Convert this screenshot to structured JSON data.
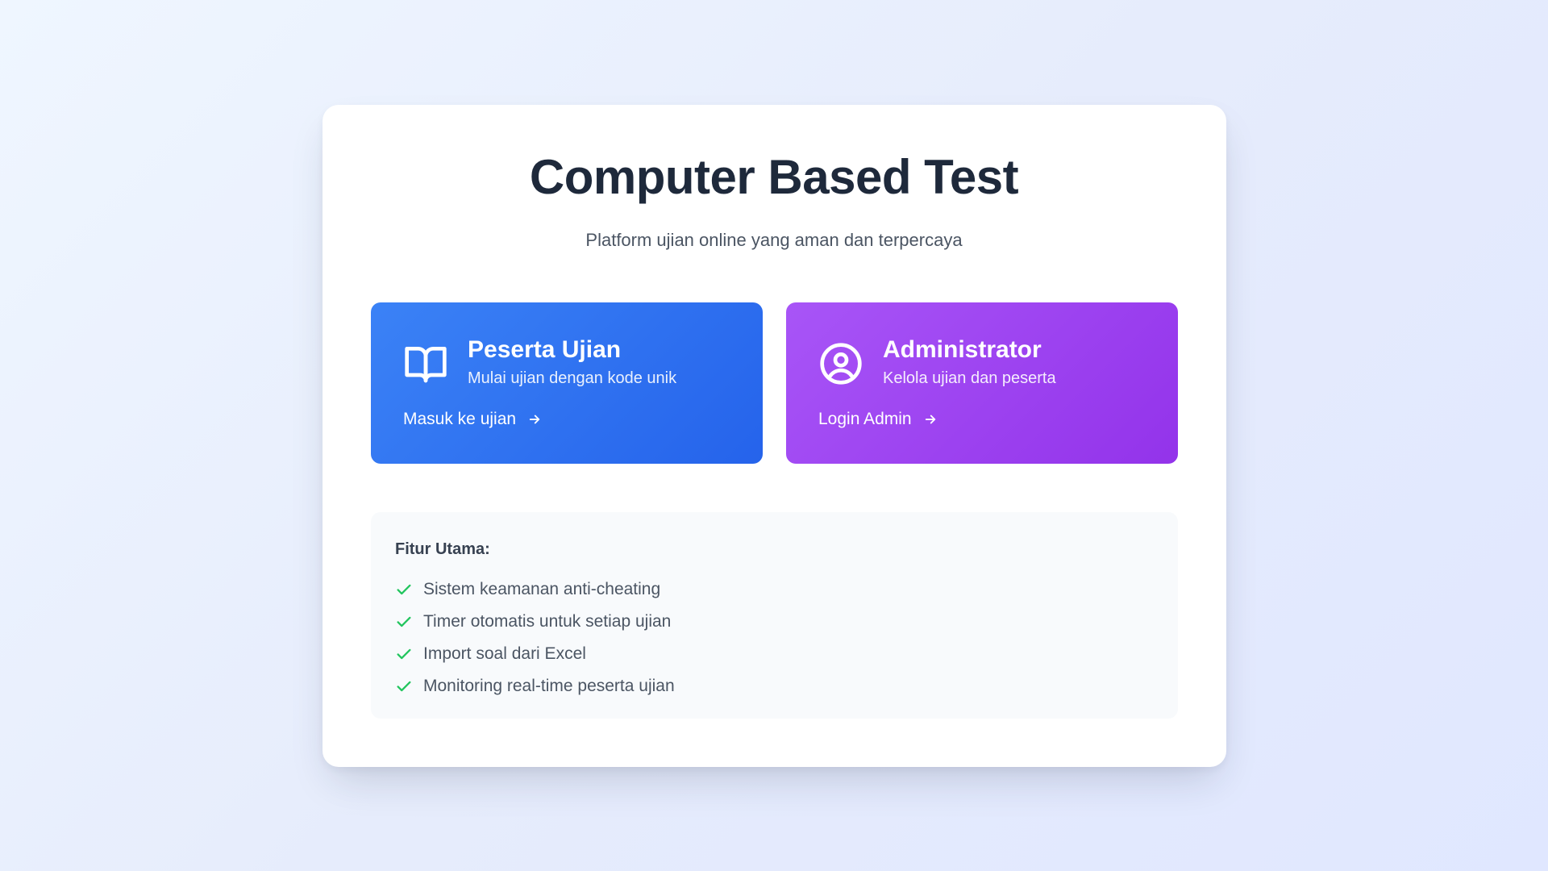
{
  "header": {
    "title": "Computer Based Test",
    "subtitle": "Platform ujian online yang aman dan terpercaya"
  },
  "roles": [
    {
      "title": "Peserta Ujian",
      "description": "Mulai ujian dengan kode unik",
      "action_label": "Masuk ke ujian",
      "icon": "book-open-icon",
      "color": "#2563eb"
    },
    {
      "title": "Administrator",
      "description": "Kelola ujian dan peserta",
      "action_label": "Login Admin",
      "icon": "user-circle-icon",
      "color": "#9333ea"
    }
  ],
  "features": {
    "title": "Fitur Utama:",
    "check_color": "#22c55e",
    "items": [
      "Sistem keamanan anti-cheating",
      "Timer otomatis untuk setiap ujian",
      "Import soal dari Excel",
      "Monitoring real-time peserta ujian"
    ]
  }
}
